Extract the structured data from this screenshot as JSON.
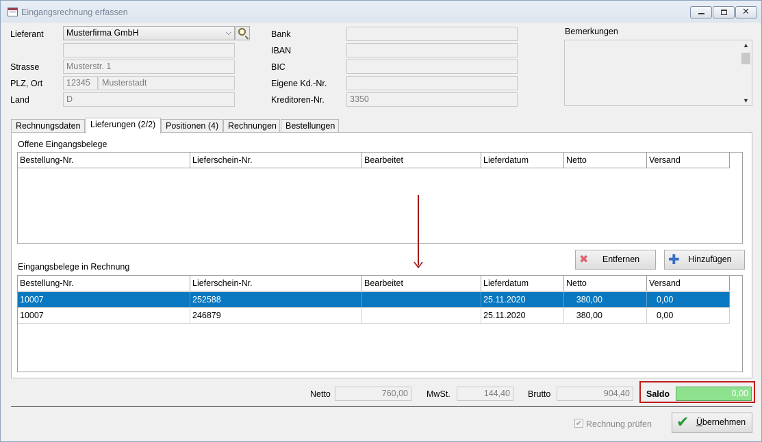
{
  "window": {
    "title": "Eingangsrechnung erfassen",
    "close_glyph": "✕"
  },
  "supplier": {
    "lieferant_label": "Lieferant",
    "lieferant_value": "Musterfirma GmbH",
    "name2_value": "",
    "strasse_label": "Strasse",
    "strasse_value": "Musterstr. 1",
    "plz_ort_label": "PLZ, Ort",
    "plz_value": "12345",
    "ort_value": "Musterstadt",
    "land_label": "Land",
    "land_value": "D"
  },
  "bank": {
    "bank_label": "Bank",
    "bank_value": "",
    "iban_label": "IBAN",
    "iban_value": "",
    "bic_label": "BIC",
    "bic_value": "",
    "eigene_label": "Eigene Kd.-Nr.",
    "eigene_value": "",
    "kreditoren_label": "Kreditoren-Nr.",
    "kreditoren_value": "3350"
  },
  "remarks": {
    "label": "Bemerkungen",
    "value": ""
  },
  "tabs": [
    {
      "label": "Rechnungsdaten"
    },
    {
      "label": "Lieferungen (2/2)"
    },
    {
      "label": "Positionen (4)"
    },
    {
      "label": "Rechnungen"
    },
    {
      "label": "Bestellungen"
    }
  ],
  "open_receipts": {
    "title": "Offene Eingangsbelege",
    "columns": [
      "Bestellung-Nr.",
      "Lieferschein-Nr.",
      "Bearbeitet",
      "Lieferdatum",
      "Netto",
      "Versand"
    ]
  },
  "actions": {
    "remove_label": "Entfernen",
    "add_label": "Hinzufügen"
  },
  "invoice_receipts": {
    "title": "Eingangsbelege in Rechnung",
    "columns": [
      "Bestellung-Nr.",
      "Lieferschein-Nr.",
      "Bearbeitet",
      "Lieferdatum",
      "Netto",
      "Versand"
    ],
    "rows": [
      {
        "bestellung": "10007",
        "lieferschein": "252588",
        "bearbeitet": "",
        "lieferdatum": "25.11.2020",
        "netto": "380,00",
        "versand": "0,00",
        "selected": true
      },
      {
        "bestellung": "10007",
        "lieferschein": "246879",
        "bearbeitet": "",
        "lieferdatum": "25.11.2020",
        "netto": "380,00",
        "versand": "0,00",
        "selected": false
      }
    ]
  },
  "totals": {
    "netto_label": "Netto",
    "netto_value": "760,00",
    "mwst_label": "MwSt.",
    "mwst_value": "144,40",
    "brutto_label": "Brutto",
    "brutto_value": "904,40",
    "saldo_label": "Saldo",
    "saldo_value": "0,00"
  },
  "footer": {
    "check_label": "Rechnung prüfen",
    "check_checked": true,
    "check_glyph": "✔",
    "submit_label": "Übernehmen",
    "submit_underline_char": "Ü",
    "submit_rest": "bernehmen"
  },
  "colors": {
    "selection": "#0a78c0",
    "saldo_ok": "#8ee28e",
    "highlight_frame": "#c01818",
    "annotation_arrow": "#a01818"
  }
}
